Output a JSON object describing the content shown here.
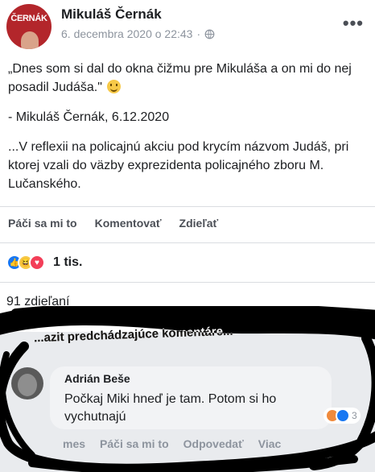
{
  "post": {
    "author": "Mikuláš Černák",
    "avatar_text": "ČERNÁK",
    "date": "6. decembra 2020 o 22:43",
    "separator": "·",
    "globe_icon": "globe-icon",
    "more_icon": "•••",
    "quote": "„Dnes som si dal do okna čižmu pre Mikuláša a on mi do nej posadil Judáša.\"",
    "attribution": "- Mikuláš Černák, 6.12.2020",
    "body": "...V reflexii na policajnú akciu pod krycím názvom Judáš, pri ktorej vzali do väzby exprezidenta policajného zboru M. Lučanského."
  },
  "actions": {
    "like": "Páči sa mi to",
    "comment": "Komentovať",
    "share": "Zdieľať"
  },
  "reactions": {
    "count": "1 tis.",
    "icons": [
      "like-icon",
      "haha-icon",
      "love-icon"
    ]
  },
  "shares": {
    "label": "91 zdieľaní"
  },
  "comments": {
    "previous_label": "...azit predchádzajúce komentáre...",
    "items": [
      {
        "author": "Adrián Beše",
        "text": "Počkaj Miki hneď je tam. Potom si ho vychutnajú",
        "reaction_count": "3",
        "actions": {
          "time": "mes",
          "like": "Páči sa mi to",
          "reply": "Odpovedať",
          "more": "Viac"
        }
      }
    ]
  },
  "colors": {
    "background": "#e9ebee",
    "card": "#ffffff",
    "text": "#1c1e21",
    "muted": "#8d949e",
    "brand": "#1877f2",
    "scribble": "#000000"
  }
}
